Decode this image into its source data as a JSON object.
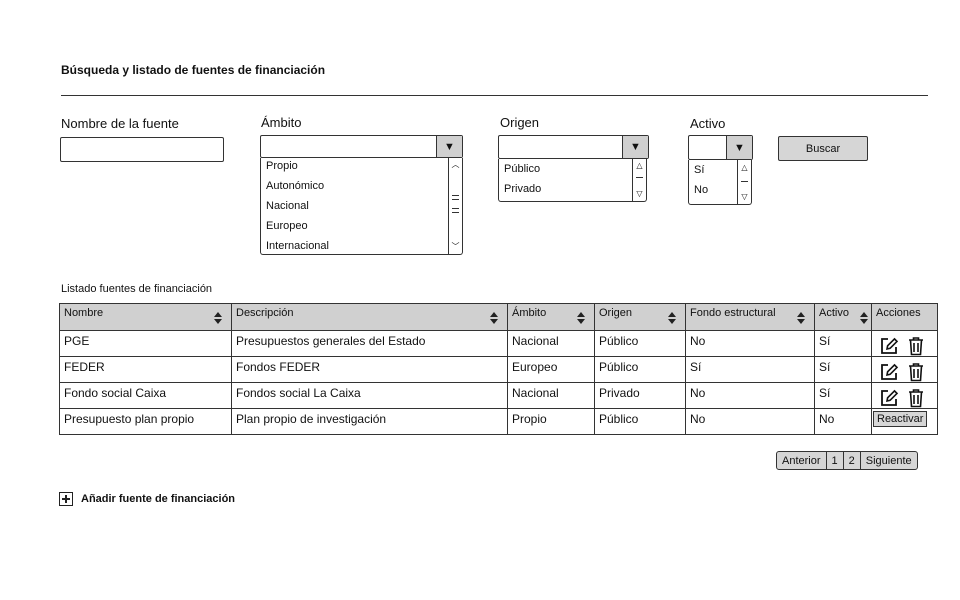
{
  "page": {
    "title": "Búsqueda y listado de fuentes de financiación",
    "list_title": "Listado fuentes de financiación",
    "add_label": "Añadir fuente de financiación"
  },
  "filters": {
    "nombre": {
      "label": "Nombre de la fuente",
      "value": ""
    },
    "ambito": {
      "label": "Ámbito",
      "value": "",
      "options": [
        "Propio",
        "Autonómico",
        "Nacional",
        "Europeo",
        "Internacional"
      ]
    },
    "origen": {
      "label": "Origen",
      "value": "",
      "options": [
        "Público",
        "Privado"
      ]
    },
    "activo": {
      "label": "Activo",
      "value": "",
      "options": [
        "Sí",
        "No"
      ]
    },
    "search_label": "Buscar"
  },
  "table": {
    "headers": [
      "Nombre",
      "Descripción",
      "Ámbito",
      "Origen",
      "Fondo estructural",
      "Activo",
      "Acciones"
    ],
    "rows": [
      {
        "nombre": "PGE",
        "descripcion": "Presupuestos generales del Estado",
        "ambito": "Nacional",
        "origen": "Público",
        "fondo": "No",
        "activo": "Sí"
      },
      {
        "nombre": "FEDER",
        "descripcion": "Fondos FEDER",
        "ambito": "Europeo",
        "origen": "Público",
        "fondo": "Sí",
        "activo": "Sí"
      },
      {
        "nombre": "Fondo social Caixa",
        "descripcion": "Fondos social La Caixa",
        "ambito": "Nacional",
        "origen": "Privado",
        "fondo": "No",
        "activo": "Sí"
      },
      {
        "nombre": "Presupuesto plan propio",
        "descripcion": "Plan propio de investigación",
        "ambito": "Propio",
        "origen": "Público",
        "fondo": "No",
        "activo": "No",
        "action": "Reactivar"
      }
    ]
  },
  "pagination": {
    "prev": "Anterior",
    "pages": [
      "1",
      "2"
    ],
    "next": "Siguiente"
  },
  "icons": {
    "edit": "edit-icon",
    "delete": "trash-icon",
    "sort": "sort-icon",
    "add": "plus-box-icon",
    "dropdown": "caret-down-icon"
  }
}
